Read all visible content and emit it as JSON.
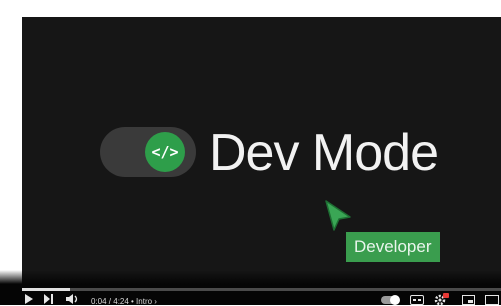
{
  "video": {
    "toggle_icon_text": "</>",
    "headline": "Dev Mode",
    "badge": "Developer"
  },
  "controls": {
    "time": "0:04 / 4:24 • Intro ›",
    "progress": 0.1,
    "icons": [
      "play-icon",
      "next-icon",
      "volume-icon",
      "autoplay-toggle",
      "subtitles-icon",
      "settings-icon",
      "miniplayer-icon",
      "theater-icon"
    ]
  },
  "colors": {
    "accent": "#2e9e4a",
    "badge": "#3a9d4e",
    "background": "#161616"
  }
}
